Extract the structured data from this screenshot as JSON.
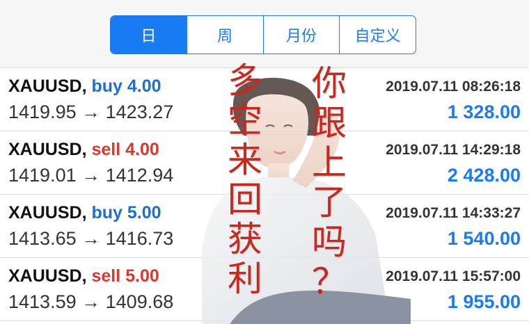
{
  "tabs": [
    {
      "label": "日",
      "active": true
    },
    {
      "label": "周",
      "active": false
    },
    {
      "label": "月份",
      "active": false
    },
    {
      "label": "自定义",
      "active": false
    }
  ],
  "deals": [
    {
      "symbol": "XAUUSD,",
      "direction": "buy 4.00",
      "type": "buy",
      "open": "1419.95",
      "arrow": "→",
      "close": "1423.27",
      "time": "2019.07.11 08:26:18",
      "profit": "1 328.00"
    },
    {
      "symbol": "XAUUSD,",
      "direction": "sell 4.00",
      "type": "sell",
      "open": "1419.01",
      "arrow": "→",
      "close": "1412.94",
      "time": "2019.07.11 14:29:18",
      "profit": "2 428.00"
    },
    {
      "symbol": "XAUUSD,",
      "direction": "buy 5.00",
      "type": "buy",
      "open": "1413.65",
      "arrow": "→",
      "close": "1416.73",
      "time": "2019.07.11 14:33:27",
      "profit": "1 540.00"
    },
    {
      "symbol": "XAUUSD,",
      "direction": "sell 5.00",
      "type": "sell",
      "open": "1413.59",
      "arrow": "→",
      "close": "1409.68",
      "time": "2019.07.11 15:57:00",
      "profit": "1 955.00"
    }
  ],
  "overlay": {
    "left_text": [
      "多",
      "空",
      "来",
      "回",
      "获",
      "利"
    ],
    "right_text": [
      "你",
      "跟",
      "上",
      "了",
      "吗",
      "？"
    ]
  },
  "colors": {
    "accent": "#1a7cf2",
    "buy": "#1a6fd8",
    "sell": "#d9382e",
    "calligraphy": "#c8281e"
  }
}
